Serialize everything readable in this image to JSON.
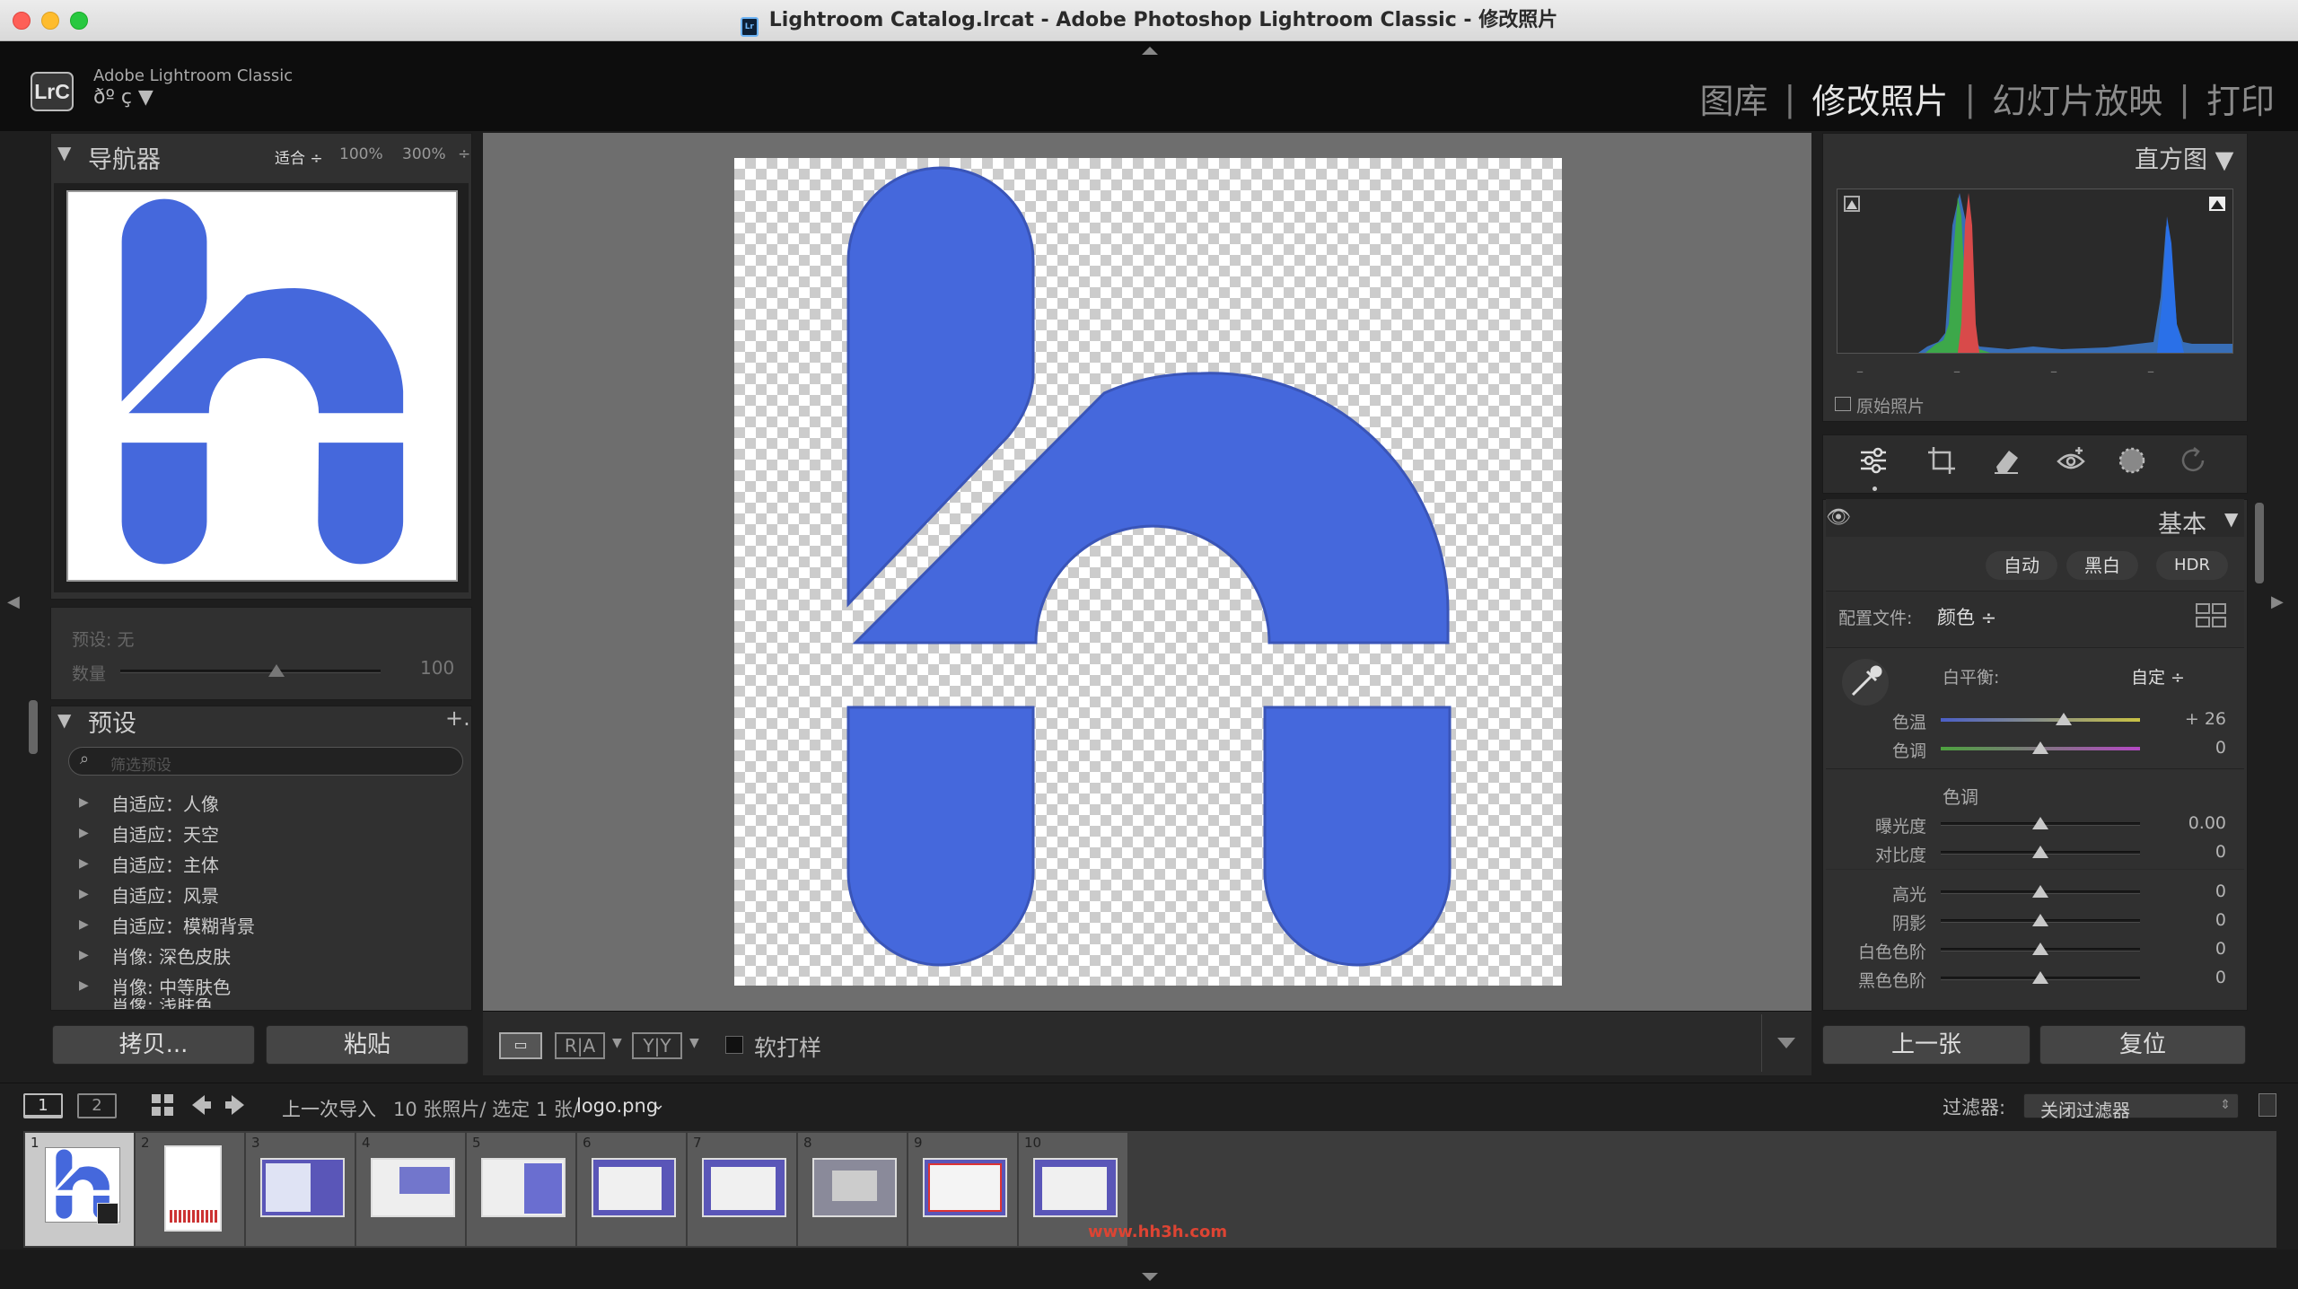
{
  "window": {
    "title": "Lightroom Catalog.lrcat - Adobe Photoshop Lightroom Classic - 修改照片",
    "app_icon": "Lr"
  },
  "identity": {
    "app_name": "Adobe Lightroom Classic",
    "user_line": "ðº ç ▼",
    "logo": "LrC"
  },
  "modules": {
    "library": "图库",
    "develop": "修改照片",
    "slideshow": "幻灯片放映",
    "print": "打印",
    "separator": "|"
  },
  "navigator": {
    "title": "导航器",
    "zoom_fit": "适合 ÷",
    "zoom_100": "100%",
    "zoom_300": "300%",
    "zoom_more": "÷"
  },
  "preset_amount": {
    "preset_label": "预设: 无",
    "amount_label": "数量",
    "amount_value": "100",
    "amount_fraction": 0.6
  },
  "presets": {
    "title": "预设",
    "add": "+.",
    "search_placeholder": "筛选预设",
    "items": [
      "自适应：人像",
      "自适应：天空",
      "自适应：主体",
      "自适应：风景",
      "自适应：模糊背景",
      "肖像: 深色皮肤",
      "肖像: 中等肤色",
      "肖像: 浅肤色"
    ]
  },
  "left_buttons": {
    "copy": "拷贝...",
    "paste": "粘贴"
  },
  "toolbar": {
    "view_rect": "▭",
    "ra": "R|A",
    "yy": "Y|Y",
    "soft_proof": "软打样"
  },
  "histogram": {
    "title": "直方图 ▼",
    "original_photo": "原始照片",
    "dashes": [
      "–",
      "–",
      "–",
      "–"
    ]
  },
  "tools": [
    "sliders-icon",
    "crop-icon",
    "eraser-icon",
    "redeye-icon",
    "masking-icon",
    "reset-icon"
  ],
  "basic": {
    "title": "基本",
    "auto": "自动",
    "bw": "黑白",
    "hdr": "HDR",
    "profile_label": "配置文件:",
    "profile_value": "颜色 ÷",
    "wb_label": "白平衡:",
    "wb_value": "自定 ÷",
    "temp_label": "色温",
    "temp_value": "+ 26",
    "tint_label": "色调",
    "tint_value": "0",
    "tone_header": "色调",
    "exposure_label": "曝光度",
    "exposure_value": "0.00",
    "contrast_label": "对比度",
    "contrast_value": "0",
    "highlights_label": "高光",
    "highlights_value": "0",
    "shadows_label": "阴影",
    "shadows_value": "0",
    "whites_label": "白色色阶",
    "whites_value": "0",
    "blacks_label": "黑色色阶",
    "blacks_value": "0"
  },
  "right_buttons": {
    "prev": "上一张",
    "reset": "复位"
  },
  "filmstrip_bar": {
    "screen1": "1",
    "screen2": "2",
    "source": "上一次导入",
    "count": "10 张照片/ 选定 1 张/",
    "file": "logo.png",
    "file_arrow": "⌄",
    "filter_label": "过滤器:",
    "filter_value": "关闭过滤器"
  },
  "filmstrip": {
    "numbers": [
      "1",
      "2",
      "3",
      "4",
      "5",
      "6",
      "7",
      "8",
      "9",
      "10"
    ]
  },
  "watermark": "www.hh3h.com",
  "colors": {
    "accent_blue": "#4568dc",
    "panel": "#303030",
    "bg": "#1e1e1e"
  }
}
